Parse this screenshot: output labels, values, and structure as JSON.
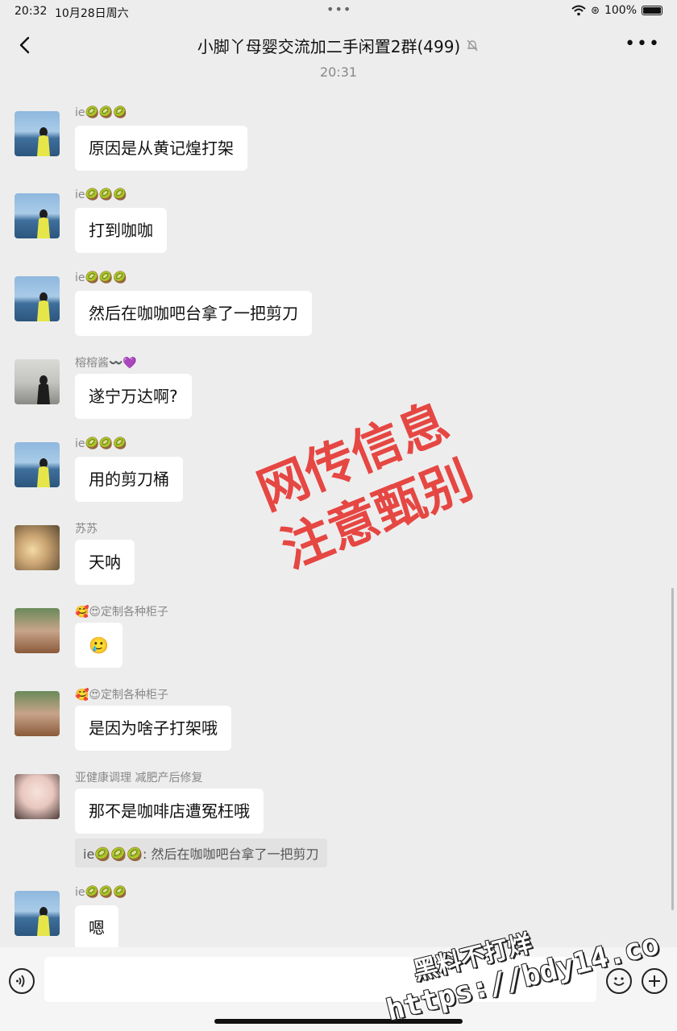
{
  "status_bar": {
    "time": "20:32",
    "date": "10月28日周六",
    "battery": "100%"
  },
  "header": {
    "title": "小脚丫母婴交流加二手闲置2群(499)"
  },
  "timestamp": "20:31",
  "messages": [
    {
      "sender": "ie🥝🥝🥝",
      "text": "原因是从黄记煌打架",
      "avatar": "avatar-sea"
    },
    {
      "sender": "ie🥝🥝🥝",
      "text": "打到咖咖",
      "avatar": "avatar-sea"
    },
    {
      "sender": "ie🥝🥝🥝",
      "text": "然后在咖咖吧台拿了一把剪刀",
      "avatar": "avatar-sea"
    },
    {
      "sender": "榕榕酱〰️💜",
      "text": "遂宁万达啊?",
      "avatar": "avatar-beach"
    },
    {
      "sender": "ie🥝🥝🥝",
      "text": "用的剪刀桶",
      "avatar": "avatar-sea"
    },
    {
      "sender": "苏苏",
      "text": "天呐",
      "avatar": "avatar-food"
    },
    {
      "sender": "🥰😍定制各种柜子",
      "text": "🥲",
      "avatar": "avatar-child"
    },
    {
      "sender": "🥰😍定制各种柜子",
      "text": "是因为啥子打架哦",
      "avatar": "avatar-child"
    },
    {
      "sender": "亚健康调理 减肥产后修复",
      "text": "那不是咖啡店遭冤枉哦",
      "avatar": "avatar-girl",
      "quote": "ie🥝🥝🥝: 然后在咖咖吧台拿了一把剪刀"
    },
    {
      "sender": "ie🥝🥝🥝",
      "text": "嗯",
      "avatar": "avatar-sea"
    }
  ],
  "watermark": {
    "line1": "网传信息",
    "line2": "注意甄别"
  },
  "site_watermark": {
    "line1": "黑料不打烊",
    "line2": "https://bdy14.co"
  },
  "icons": [
    "back-icon",
    "mute-bell-icon",
    "more-icon",
    "voice-icon",
    "emoji-icon",
    "plus-icon",
    "wifi-icon",
    "battery-icon"
  ]
}
